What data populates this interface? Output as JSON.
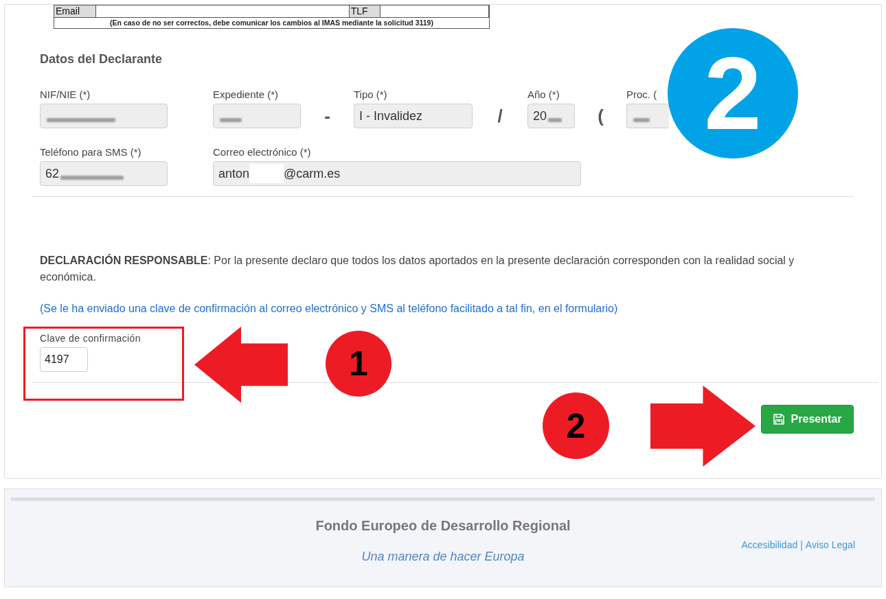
{
  "document_excerpt": {
    "cells": [
      {
        "kind": "header",
        "text": "Email"
      },
      {
        "kind": "blank"
      },
      {
        "kind": "header",
        "text": "TLF"
      },
      {
        "kind": "blank"
      }
    ],
    "note": "(En caso de no ser correctos, debe comunicar los cambios al IMAS mediante la solicitud 3119)"
  },
  "section_title": "Datos del Declarante",
  "field_rows": [
    [
      {
        "kind": "field",
        "label": "NIF/NIE (*)",
        "segments": [
          {
            "kind": "blurred"
          }
        ]
      },
      {
        "kind": "field",
        "label": "Expediente (*)",
        "segments": [
          {
            "kind": "blurred"
          }
        ]
      },
      {
        "kind": "separator",
        "text": "-"
      },
      {
        "kind": "field",
        "label": "Tipo (*)",
        "segments": [
          {
            "kind": "text",
            "text": "I - Invalidez"
          }
        ]
      },
      {
        "kind": "separator",
        "text": "/"
      },
      {
        "kind": "field",
        "label": "Año (*)",
        "segments": [
          {
            "kind": "text",
            "text": "20"
          },
          {
            "kind": "blurred"
          }
        ]
      },
      {
        "kind": "separator",
        "text": "("
      },
      {
        "kind": "field",
        "label": "Proc. (",
        "segments": [
          {
            "kind": "blurred"
          }
        ]
      }
    ],
    [
      {
        "kind": "field",
        "label": "Teléfono para SMS (*)",
        "segments": [
          {
            "kind": "text",
            "text": "62"
          },
          {
            "kind": "blurred"
          }
        ]
      },
      {
        "kind": "field",
        "label": "Correo electrónico (*)",
        "segments": [
          {
            "kind": "text",
            "text": "anton"
          },
          {
            "kind": "blank"
          },
          {
            "kind": "text",
            "text": "@carm.es"
          }
        ]
      }
    ]
  ],
  "declaration": "**DECLARACIÓN RESPONSABLE**: Por la presente declaro que todos los datos aportados en la presente declaración corresponden con la realidad social y económica.",
  "notice": "(Se le ha enviado una clave de confirmación al correo electrónico y SMS al teléfono facilitado a tal fin, en el formulario)",
  "confirmation": {
    "label": "Clave de confirmación",
    "value": "4197"
  },
  "submit_button": {
    "label": "Presentar"
  },
  "footer": {
    "title": "Fondo Europeo de Desarrollo Regional",
    "slogan": "Una manera de hacer Europa",
    "links": [
      {
        "label": "Accesibilidad"
      },
      {
        "label": "Aviso Legal"
      }
    ],
    "link_separator": "|"
  },
  "annotations": [
    {
      "kind": "badge",
      "text": "2",
      "color": "#02a3e6"
    },
    {
      "kind": "frame"
    },
    {
      "kind": "leftarrow"
    },
    {
      "kind": "badge",
      "text": "1",
      "color": "#ed1c24"
    },
    {
      "kind": "badge",
      "text": "2",
      "color": "#ed1c24"
    },
    {
      "kind": "rightarrow"
    }
  ]
}
